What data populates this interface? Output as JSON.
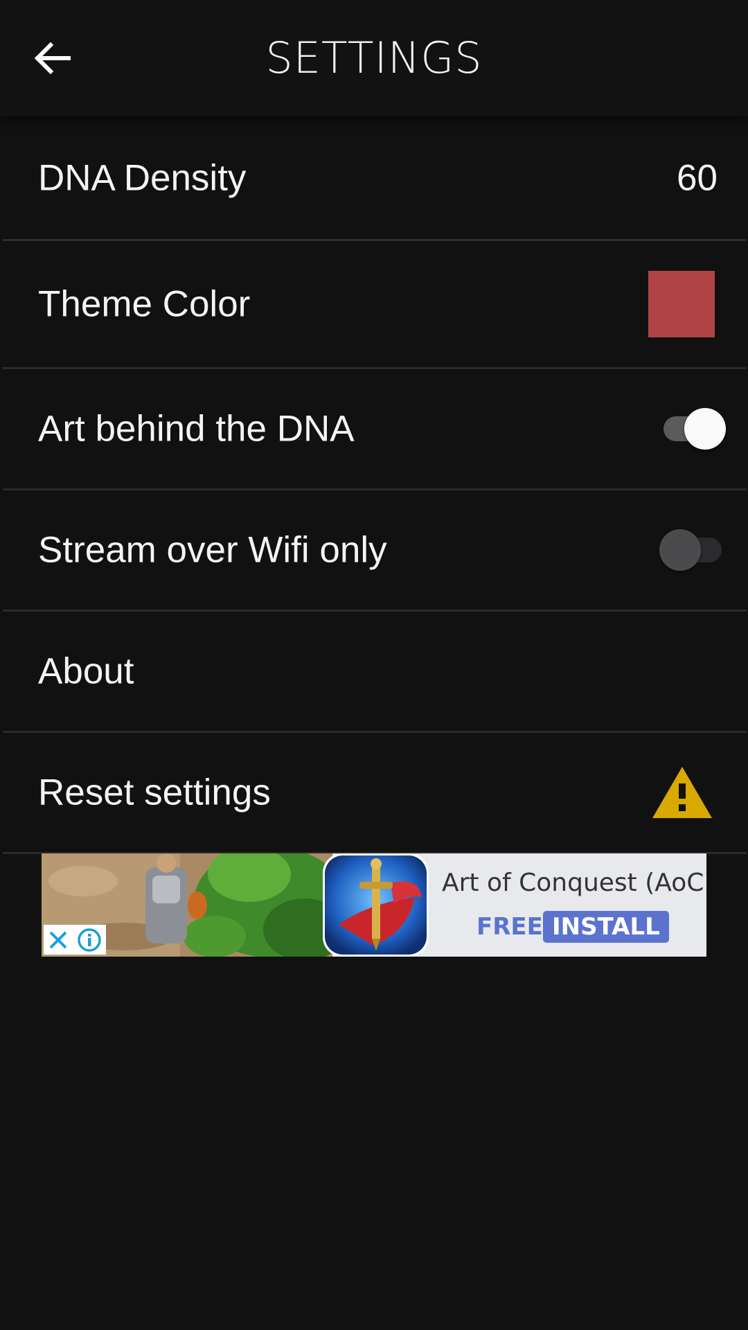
{
  "header": {
    "title": "SETTINGS",
    "back_icon": "arrow-left-icon"
  },
  "settings": {
    "dna_density": {
      "label": "DNA Density",
      "value": "60"
    },
    "theme_color": {
      "label": "Theme Color",
      "color": "#b04445"
    },
    "art_behind_dna": {
      "label": "Art behind the DNA",
      "enabled": true
    },
    "stream_wifi_only": {
      "label": "Stream over Wifi only",
      "enabled": false
    },
    "about": {
      "label": "About"
    },
    "reset": {
      "label": "Reset settings",
      "icon": "warning-icon",
      "icon_color": "#d8a900"
    }
  },
  "ad": {
    "title": "Art of Conquest (AoC)",
    "free_label": "FREE",
    "install_label": "INSTALL",
    "accent_color": "#5b73cf"
  },
  "colors": {
    "background": "#111112",
    "divider": "#2b2b2c",
    "text": "#f4f4f4"
  }
}
